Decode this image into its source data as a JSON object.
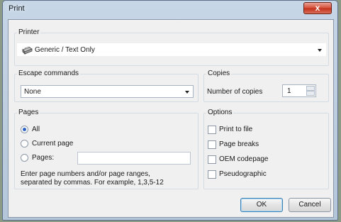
{
  "window": {
    "title": "Print",
    "close_glyph": "x"
  },
  "printer": {
    "group_label": "Printer",
    "selected": "Generic / Text Only",
    "icon": "printer-icon"
  },
  "escape": {
    "group_label": "Escape commands",
    "selected": "None"
  },
  "copies": {
    "group_label": "Copies",
    "label": "Number of copies",
    "value": "1"
  },
  "pages": {
    "group_label": "Pages",
    "options": [
      "All",
      "Current page",
      "Pages:"
    ],
    "selected_index": 0,
    "pages_value": "",
    "hint_line1": "Enter page numbers and/or page ranges,",
    "hint_line2": "separated by commas. For example, 1,3,5-12"
  },
  "options": {
    "group_label": "Options",
    "items": [
      {
        "label": "Print to file",
        "checked": false
      },
      {
        "label": "Page breaks",
        "checked": false
      },
      {
        "label": "OEM codepage",
        "checked": false
      },
      {
        "label": "Pseudographic",
        "checked": false
      }
    ]
  },
  "buttons": {
    "ok": "OK",
    "cancel": "Cancel"
  }
}
